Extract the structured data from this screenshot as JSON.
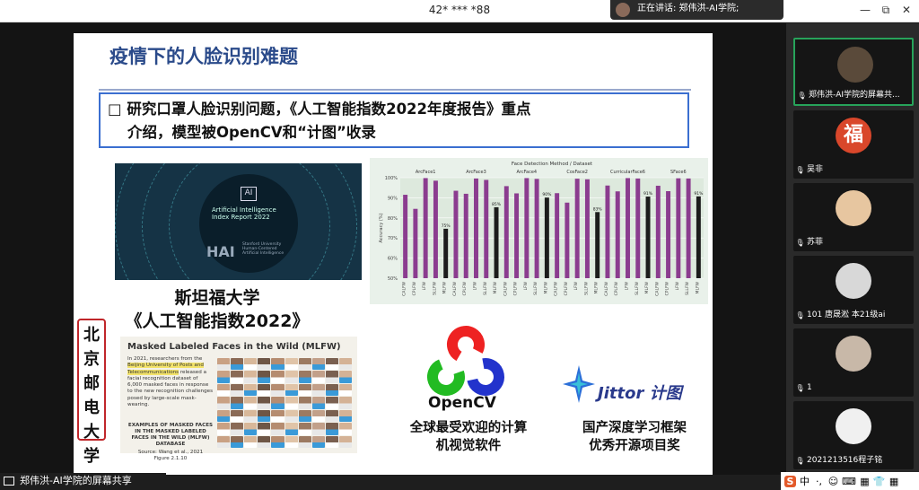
{
  "window": {
    "title": "42* *** *88",
    "speaking": "正在讲话: 郑伟洪-AI学院;",
    "min": "—",
    "max": "⧉",
    "close": "✕"
  },
  "slide": {
    "title": "疫情下的人脸识别难题",
    "box_line1": "□ 研究口罩人脸识别问题，《人工智能指数2022年度报告》重点",
    "box_line2": "介绍，模型被OpenCV和“计图”收录",
    "hai": {
      "logo": "AI",
      "title1": "Artificial Intelligence",
      "title2": "Index Report 2022",
      "sub1": "Stanford University",
      "sub2": "Human-Centered",
      "sub3": "Artificial Intelligence",
      "brand": "HAI"
    },
    "cap1_line1": "斯坦福大学",
    "cap1_line2": "《人工智能指数2022》",
    "vertical_label": [
      "北",
      "京",
      "邮",
      "电",
      "大",
      "学"
    ],
    "mlfw": {
      "title": "Masked Labeled Faces in the Wild (MLFW)",
      "para_a": "In 2021, researchers from the ",
      "para_hl": "Beijing University of Posts and Telecommunications",
      "para_b": " released a facial recognition dataset of 6,000 masked faces in response to the new recognition challenges posed by large-scale mask-wearing.",
      "examples": "EXAMPLES OF MASKED FACES IN THE MASKED LABELED FACES IN THE WILD (MLFW) DATABASE",
      "source": "Source: Wang et al., 2021",
      "figure": "Figure 2.1.10"
    },
    "opencv": "OpenCV",
    "cap2_line1": "全球最受欢迎的计算",
    "cap2_line2": "机视觉软件",
    "jittor": "Jittor 计图",
    "cap3_line1": "国产深度学习框架",
    "cap3_line2": "优秀开源项目奖"
  },
  "chart_data": {
    "type": "bar",
    "title": "Face Detection Method / Dataset",
    "ylabel": "Accuracy (%)",
    "ylim": [
      50,
      100
    ],
    "yticks": [
      "100%",
      "90%",
      "80%",
      "70%",
      "60%",
      "50%"
    ],
    "groups": [
      {
        "name": "ArcFace1",
        "categories": [
          "CALFW",
          "CPLFW",
          "LFW",
          "SLLFW",
          "MLFW"
        ],
        "values": [
          91.5,
          84.5,
          99.8,
          98.5,
          74.6
        ],
        "labels": [
          "",
          "",
          "",
          "",
          "75%"
        ]
      },
      {
        "name": "ArcFace3",
        "categories": [
          "CALFW",
          "CPLFW",
          "LFW",
          "SLLFW",
          "MLFW"
        ],
        "values": [
          93.5,
          92,
          99.6,
          98.9,
          85.3
        ],
        "labels": [
          "",
          "",
          "",
          "",
          "85%"
        ]
      },
      {
        "name": "ArcFace4",
        "categories": [
          "CALFW",
          "CPLFW",
          "LFW",
          "SLLFW",
          "MLFW"
        ],
        "values": [
          95.8,
          92.2,
          99.8,
          99.4,
          90.1
        ],
        "labels": [
          "",
          "",
          "",
          "",
          "90%"
        ]
      },
      {
        "name": "CosFace2",
        "categories": [
          "CALFW",
          "CPLFW",
          "LFW",
          "SLLFW",
          "MLFW"
        ],
        "values": [
          92.3,
          87.6,
          99.5,
          99.2,
          82.9
        ],
        "labels": [
          "",
          "",
          "",
          "",
          "83%"
        ]
      },
      {
        "name": "CurricularFace6",
        "categories": [
          "CALFW",
          "CPLFW",
          "LFW",
          "SLLFW",
          "MLFW"
        ],
        "values": [
          96.1,
          93.2,
          99.8,
          99.6,
          90.6
        ],
        "labels": [
          "",
          "",
          "",
          "",
          "91%"
        ]
      },
      {
        "name": "SFace6",
        "categories": [
          "CALFW",
          "CPLFW",
          "LFW",
          "SLLFW",
          "MLFW"
        ],
        "values": [
          96.0,
          93.3,
          99.7,
          99.6,
          90.7
        ],
        "labels": [
          "",
          "",
          "",
          "",
          "91%"
        ]
      }
    ],
    "colors": {
      "bar": "#8b3c8f",
      "mlfw": "#1c1c1c"
    }
  },
  "bottom": {
    "label": "郑伟洪-AI学院的屏幕共享"
  },
  "participants": [
    {
      "name": "郑伟洪-AI学院的屏幕共...",
      "active": true,
      "avatar": "#5a4a3a"
    },
    {
      "name": "吴非",
      "avatar": "#d9472b",
      "glyph": "福"
    },
    {
      "name": "苏菲",
      "avatar": "#e7c6a0"
    },
    {
      "name": "101 唐晟淞 本21级ai",
      "avatar": "#d8d8d8"
    },
    {
      "name": "1",
      "avatar": "#c8b8a8"
    },
    {
      "name": "2021213516程子铭",
      "avatar": "#f0f0f0"
    }
  ],
  "tray": [
    "S",
    "中",
    "·,",
    "☺",
    "⌨",
    "▦",
    "👕",
    "▦"
  ]
}
